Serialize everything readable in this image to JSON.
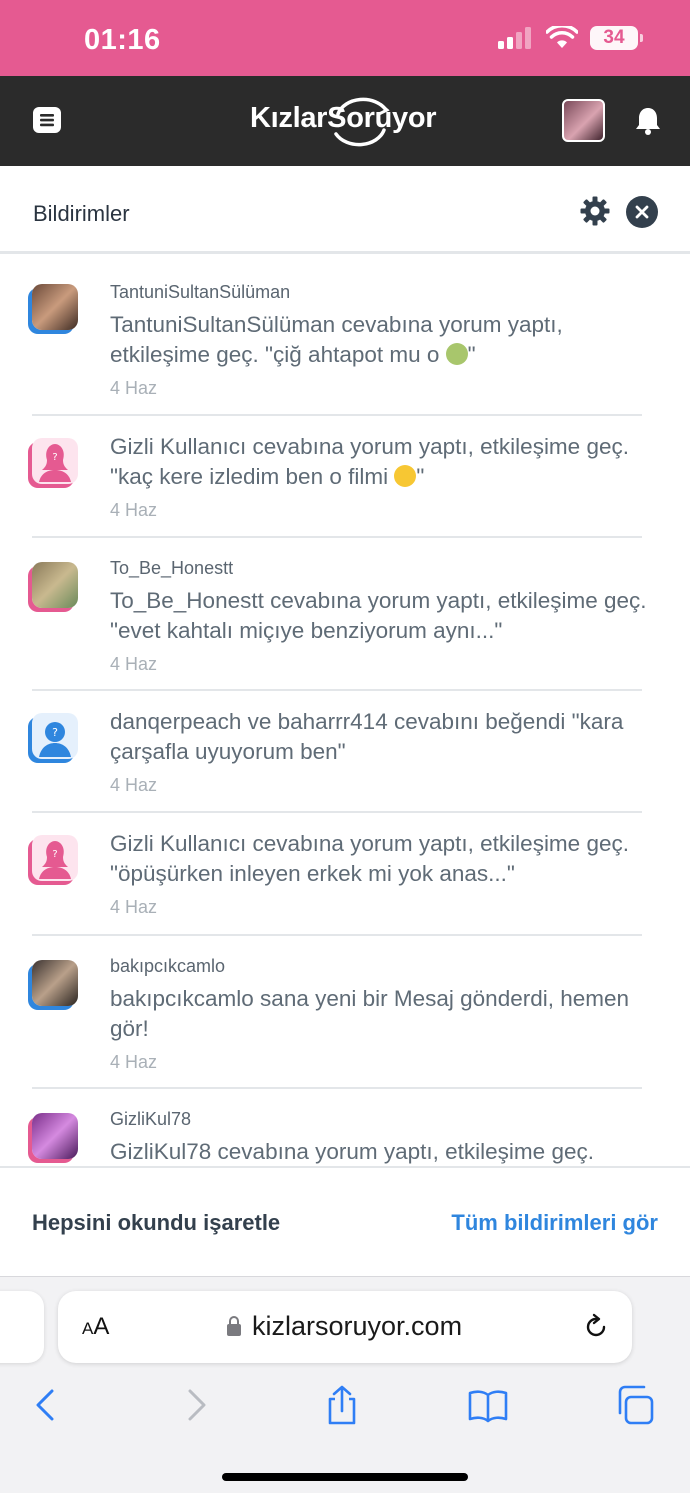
{
  "status_bar": {
    "time": "01:16",
    "battery": "34"
  },
  "app": {
    "logo": "KızlarSoruyor"
  },
  "panel": {
    "title": "Bildirimler"
  },
  "notifications": [
    {
      "user": "TantuniSultanSülüman",
      "text": "TantuniSultanSülüman cevabına yorum yaptı, etkileşime geç. \"çiğ ahtapot mu o ",
      "text_tail": "\"",
      "date": "4 Haz"
    },
    {
      "user": "",
      "text": "Gizli Kullanıcı cevabına yorum yaptı, etkileşime geç. \"kaç kere izledim ben o filmi ",
      "text_tail": "\"",
      "date": "4 Haz"
    },
    {
      "user": "To_Be_Honestt",
      "text": "To_Be_Honestt cevabına yorum yaptı, etkileşime geç. \"evet kahtalı miçıye benziyorum aynı...\"",
      "date": "4 Haz"
    },
    {
      "user": "",
      "text": "danqerpeach ve baharrr414 cevabını beğendi \"kara çarşafla uyuyorum ben\"",
      "date": "4 Haz"
    },
    {
      "user": "",
      "text": "Gizli Kullanıcı cevabına yorum yaptı, etkileşime geç. \"öpüşürken inleyen erkek mi yok anas...\"",
      "date": "4 Haz"
    },
    {
      "user": "bakıpcıkcamlo",
      "text": "bakıpcıkcamlo sana yeni bir Mesaj gönderdi, hemen gör!",
      "date": "4 Haz"
    },
    {
      "user": "GizliKul78",
      "text": "GizliKul78 cevabına yorum yaptı, etkileşime geç."
    }
  ],
  "footer": {
    "mark_read": "Hepsini okundu işaretle",
    "see_all": "Tüm bildirimleri gör"
  },
  "safari": {
    "aa_small": "A",
    "aa_big": "A",
    "url": "kizlarsoruyor.com"
  },
  "colors": {
    "brand_pink": "#e55a91",
    "header_dark": "#2b2b2b",
    "link_blue": "#2f86de"
  }
}
